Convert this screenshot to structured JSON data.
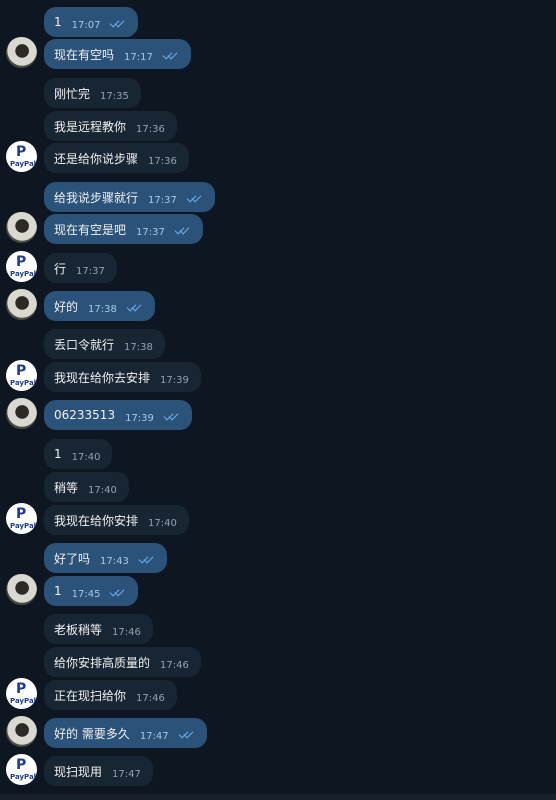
{
  "messages": [
    {
      "text": "1",
      "time": "17:07",
      "dir": "out",
      "avatar": "none"
    },
    {
      "text": "现在有空吗",
      "time": "17:17",
      "dir": "out",
      "avatar": "dark"
    },
    {
      "text": "刚忙完",
      "time": "17:35",
      "dir": "in",
      "avatar": "none"
    },
    {
      "text": "我是远程教你",
      "time": "17:36",
      "dir": "in",
      "avatar": "none"
    },
    {
      "text": "还是给你说步骤",
      "time": "17:36",
      "dir": "in",
      "avatar": "paypal"
    },
    {
      "text": "给我说步骤就行",
      "time": "17:37",
      "dir": "out",
      "avatar": "none"
    },
    {
      "text": "现在有空是吧",
      "time": "17:37",
      "dir": "out",
      "avatar": "dark"
    },
    {
      "text": "行",
      "time": "17:37",
      "dir": "in",
      "avatar": "paypal"
    },
    {
      "text": "好的",
      "time": "17:38",
      "dir": "out",
      "avatar": "dark"
    },
    {
      "text": "丢口令就行",
      "time": "17:38",
      "dir": "in",
      "avatar": "none"
    },
    {
      "text": "我现在给你去安排",
      "time": "17:39",
      "dir": "in",
      "avatar": "paypal"
    },
    {
      "text": "06233513",
      "time": "17:39",
      "dir": "out",
      "avatar": "dark"
    },
    {
      "text": "1",
      "time": "17:40",
      "dir": "in",
      "avatar": "none"
    },
    {
      "text": "稍等",
      "time": "17:40",
      "dir": "in",
      "avatar": "none"
    },
    {
      "text": "我现在给你安排",
      "time": "17:40",
      "dir": "in",
      "avatar": "paypal"
    },
    {
      "text": "好了吗",
      "time": "17:43",
      "dir": "out",
      "avatar": "none"
    },
    {
      "text": "1",
      "time": "17:45",
      "dir": "out",
      "avatar": "dark"
    },
    {
      "text": "老板稍等",
      "time": "17:46",
      "dir": "in",
      "avatar": "none"
    },
    {
      "text": "给你安排高质量的",
      "time": "17:46",
      "dir": "in",
      "avatar": "none"
    },
    {
      "text": "正在现扫给你",
      "time": "17:46",
      "dir": "in",
      "avatar": "paypal"
    },
    {
      "text": "好的 需要多久",
      "time": "17:47",
      "dir": "out",
      "avatar": "dark"
    },
    {
      "text": "现扫现用",
      "time": "17:47",
      "dir": "in",
      "avatar": "paypal"
    }
  ],
  "paypal_text": "PayPal",
  "paypal_letter": "P",
  "colors": {
    "background": "#0e1621",
    "incoming": "#182533",
    "outgoing": "#2b5278",
    "check": "#6cb1f0"
  }
}
